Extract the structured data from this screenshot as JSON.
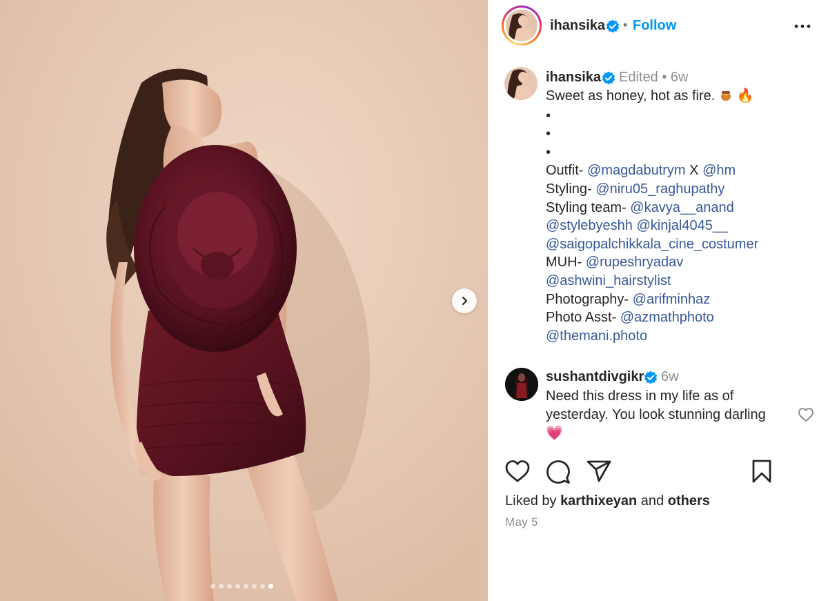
{
  "post": {
    "username": "ihansika",
    "follow_label": "Follow",
    "separator": "•",
    "image_count": 8,
    "active_image": 8,
    "icons": {
      "verified": "verified-badge-icon",
      "more": "more-options-icon",
      "next": "chevron-right-icon",
      "like": "heart-icon",
      "comment": "comment-bubble-icon",
      "share": "paper-plane-icon",
      "save": "bookmark-icon"
    },
    "colors": {
      "accent": "#0095f6",
      "mention": "#385898",
      "verified": "#0095f6",
      "muted": "#8e8e8e"
    }
  },
  "caption": {
    "username": "ihansika",
    "edited": "Edited",
    "time": "6w",
    "text": "Sweet as honey, hot as fire.",
    "emoji_fire": "🔥",
    "bullets": [
      "•",
      "•",
      "•"
    ],
    "credits": {
      "outfit_label": "Outfit-",
      "outfit_mention_1": "@magdabutrym",
      "outfit_x": "X",
      "outfit_mention_2": "@hm",
      "styling_label": "Styling-",
      "styling_mention": "@niru05_raghupathy",
      "styling_team_label": "Styling team-",
      "styling_team_1": "@kavya__anand",
      "styling_team_2": "@stylebyeshh",
      "styling_team_3": "@kinjal4045__",
      "styling_team_4": "@saigopalchikkala_cine_costumer",
      "muh_label": "MUH-",
      "muh_1": "@rupeshryadav",
      "muh_2": "@ashwini_hairstylist",
      "photography_label": "Photography-",
      "photography_mention": "@arifminhaz",
      "photo_asst_label": "Photo Asst-",
      "photo_asst_1": "@azmathphoto",
      "photo_asst_2": "@themani.photo"
    }
  },
  "comment": {
    "username": "sushantdivgikr",
    "time": "6w",
    "text": "Need this dress in my life as of yesterday. You look stunning darling",
    "emoji": "💗"
  },
  "engagement": {
    "liked_by_prefix": "Liked by",
    "liked_by_user": "karthixeyan",
    "liked_by_and": "and",
    "liked_by_others": "others",
    "date": "May 5"
  }
}
